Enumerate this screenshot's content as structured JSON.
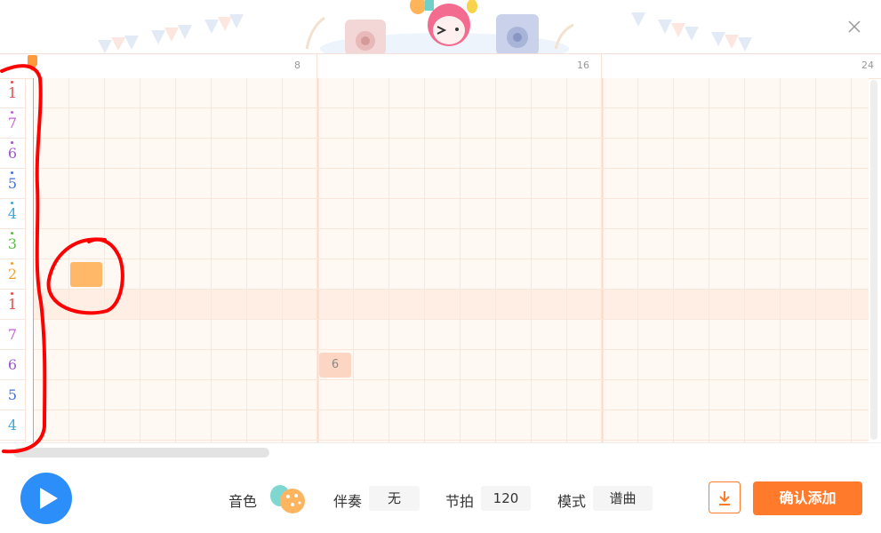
{
  "ruler": {
    "ticks": [
      "8",
      "16",
      "24"
    ]
  },
  "notes": [
    {
      "label": "1",
      "octave": "high",
      "color": "#e84b4b"
    },
    {
      "label": "7",
      "octave": "high",
      "color": "#c062d8"
    },
    {
      "label": "6",
      "octave": "high",
      "color": "#9b59d0"
    },
    {
      "label": "5",
      "octave": "high",
      "color": "#4a6fd8"
    },
    {
      "label": "4",
      "octave": "high",
      "color": "#3da6e0"
    },
    {
      "label": "3",
      "octave": "high",
      "color": "#5dbb4a"
    },
    {
      "label": "2",
      "octave": "high",
      "color": "#f0a030"
    },
    {
      "label": "1",
      "octave": "high",
      "color": "#e84b4b"
    },
    {
      "label": "7",
      "octave": "mid",
      "color": "#c062d8"
    },
    {
      "label": "6",
      "octave": "mid",
      "color": "#9b59d0"
    },
    {
      "label": "5",
      "octave": "mid",
      "color": "#4a6fd8"
    },
    {
      "label": "4",
      "octave": "mid",
      "color": "#3da6e0"
    }
  ],
  "placed_notes": [
    {
      "row": 6,
      "beat": 1,
      "label": "",
      "color": "#ffb868"
    },
    {
      "row": 9,
      "beat": 8,
      "label": "6",
      "color": "#fcd6c2"
    }
  ],
  "highlight_row": 7,
  "toolbar": {
    "timbre_label": "音色",
    "accompaniment_label": "伴奏",
    "accompaniment_value": "无",
    "tempo_label": "节拍",
    "tempo_value": "120",
    "mode_label": "模式",
    "mode_value": "谱曲",
    "confirm_label": "确认添加"
  },
  "colors": {
    "accent": "#ff7a2b",
    "play": "#2c8ef8",
    "annotation": "#ff0000"
  }
}
